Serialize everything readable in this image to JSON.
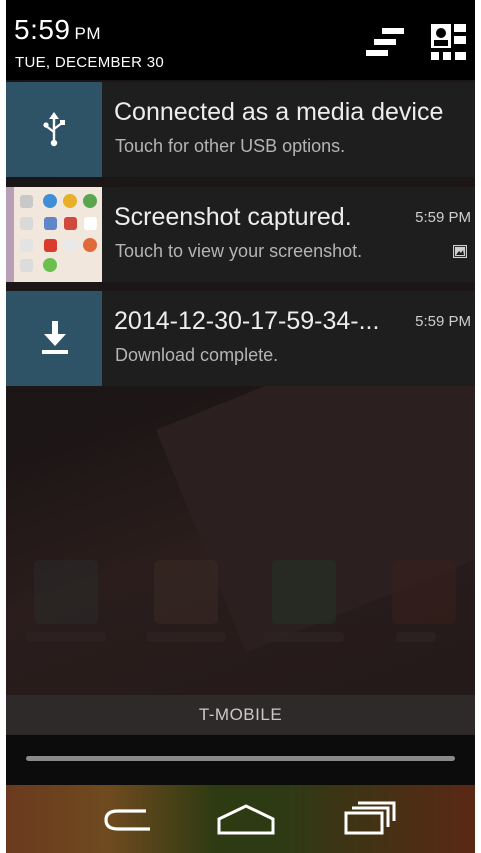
{
  "status_header": {
    "time": "5:59",
    "ampm": "PM",
    "date": "TUE, DECEMBER 30",
    "clear_all_icon": "clear-all-icon",
    "quick_settings_icon": "quick-settings-icon"
  },
  "notifications": [
    {
      "icon": "usb-icon",
      "title": "Connected as a media device",
      "subtitle": "Touch for other USB options.",
      "time": ""
    },
    {
      "icon": "screenshot-thumbnail",
      "title": "Screenshot captured.",
      "subtitle": "Touch to view your screenshot.",
      "time": "5:59 PM",
      "small_icon": "image-icon"
    },
    {
      "icon": "download-icon",
      "title": "2014-12-30-17-59-34-...",
      "subtitle": "Download complete.",
      "time": "5:59 PM"
    }
  ],
  "carrier": "T-MOBILE",
  "nav": {
    "back": "back-icon",
    "home": "home-icon",
    "recent": "recent-apps-icon"
  },
  "colors": {
    "notification_icon_bg": "#2f5366",
    "notification_bg": "#1e1e1e",
    "header_bg": "#000000"
  }
}
